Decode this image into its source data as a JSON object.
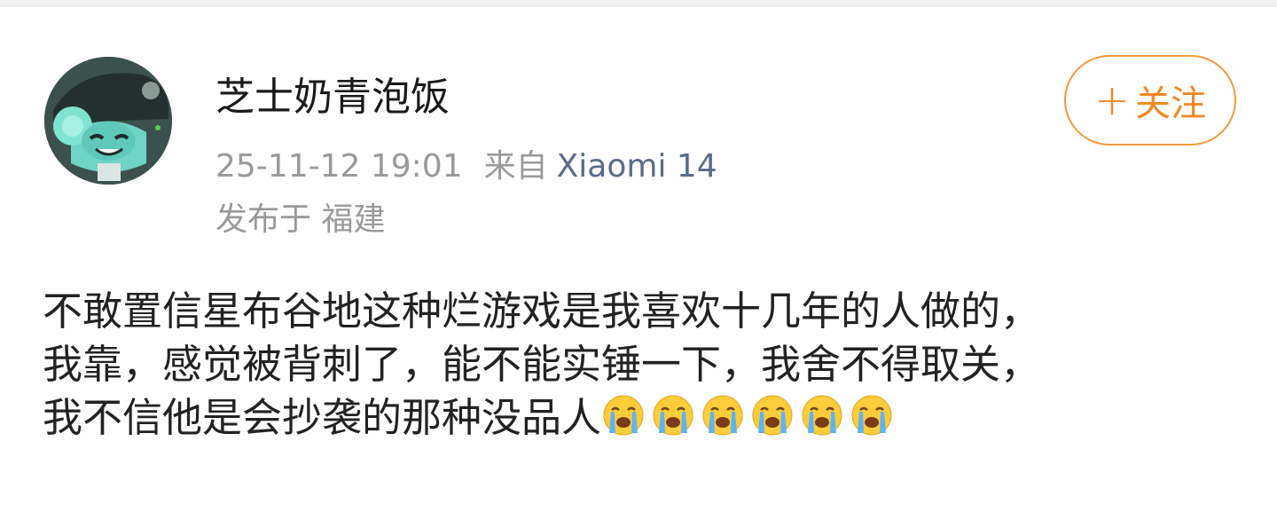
{
  "post": {
    "username": "芝士奶青泡饭",
    "timestamp": "25-11-12 19:01",
    "from_label": "来自",
    "device": "Xiaomi 14",
    "location": "发布于 福建",
    "follow_button": {
      "plus": "+",
      "label": "关注"
    },
    "content_lines": [
      "不敢置信星布谷地这种烂游戏是我喜欢十几年的人做的，",
      "我靠，感觉被背刺了，能不能实锤一下，我舍不得取关，",
      "我不信他是会抄袭的那种没品人"
    ],
    "emojis": [
      "crying-face-icon",
      "crying-face-icon",
      "crying-face-icon",
      "crying-face-icon",
      "crying-face-icon",
      "crying-face-icon"
    ]
  },
  "colors": {
    "accent": "#f08a24",
    "device_link": "#5a6a8a",
    "meta_text": "#9a9a9a",
    "body_text": "#222222"
  }
}
